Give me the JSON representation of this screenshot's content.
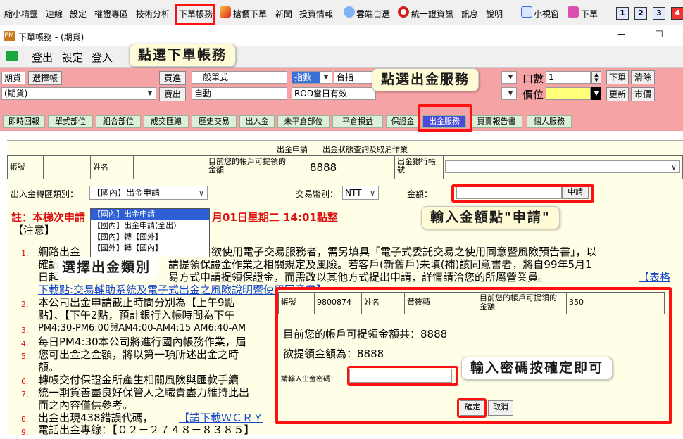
{
  "menubar": {
    "items": [
      "縮小精靈",
      "連線",
      "設定",
      "權證專區",
      "技術分析",
      "下單帳務",
      "搶價下單",
      "新聞",
      "投資情報",
      "雲端自選",
      "統一證資訊",
      "訊息",
      "說明",
      "小視窗",
      "下單"
    ],
    "num_buttons": [
      "1",
      "2",
      "3",
      "4"
    ]
  },
  "window": {
    "title": "下單帳務 - (期貨)",
    "logo": "EM",
    "minimize": "—",
    "maximize": "☐"
  },
  "toolbar": {
    "logout": "登出",
    "settings": "設定",
    "login": "登入"
  },
  "callouts": {
    "select_account": "點選下單帳務",
    "select_withdraw": "點選出金服務",
    "enter_amount": "輸入金額點\"申請\"",
    "select_type": "選擇出金類別",
    "enter_password": "輸入密碼按確定即可"
  },
  "order": {
    "account_type": "期貨",
    "select_account_btn": "選擇帳",
    "account_type2": "(期貨)",
    "buy_label": "買進",
    "sell_label": "賣出",
    "order_type": "一般單式",
    "auto": "自動",
    "index_select": "指數",
    "index_name": "台指",
    "rod": "ROD當日有效",
    "qty_label": "口數",
    "qty_value": "1",
    "price_label": "價位",
    "place_order": "下單",
    "clear": "清除",
    "update": "更新",
    "market_price": "市價"
  },
  "tabs": [
    "即時回報",
    "單式部位",
    "組合部位",
    "成交匯總",
    "歷史交易",
    "出入金",
    "未平倉部位",
    "平倉損益",
    "保證金",
    "出金服務",
    "買賣報告書",
    "個人服務"
  ],
  "form": {
    "subtab_apply": "出金申請",
    "subtab_query": "出金狀態查詢及取消作業",
    "account_label": "帳號",
    "name_label": "姓名",
    "available_label": "目前您的帳戶可提領的金額",
    "available_value": "8888",
    "bank_label": "出金銀行帳號",
    "transfer_type_label": "出入金轉匯類別：",
    "transfer_type_value": "【國內】出金申請",
    "currency_label": "交易幣別：",
    "currency_value": "NTT",
    "amount_label": "金額：",
    "apply_btn": "申請",
    "options": [
      "【國內】出金申請",
      "【國內】出金申請(全出)",
      "【國內】轉【國外】",
      "【國外】轉【國內】"
    ]
  },
  "notice": {
    "heading_left": "註：本梯次申請",
    "heading_right": "月01日星期二 14:01點整",
    "label": "【注意】",
    "lines": [
      {
        "num": "1.",
        "text": "網路出金",
        "text2": "欲使用電子交易服務者，需另填具「電子式委託交易之使用同意暨風險預告書」，以"
      },
      {
        "num": "",
        "text": "確認",
        "text2": "請提領保證金作業之相關規定及風險。若客戶(新舊戶)未填(補)該同意書者，將自99年5月1"
      },
      {
        "num": "",
        "text": "日起",
        "text2": "易方式申請提領保證金，而需改以其他方式提出申請，詳情請洽您的所屬營業員。"
      },
      {
        "num": "",
        "text": "下載點:交易輔助系統及電子式出金之風險說明暨使用同意書】",
        "text2": "【表格"
      },
      {
        "num": "2.",
        "text": "本公司出金申請截止時間分別為【上午9點"
      },
      {
        "num": "",
        "text": "點】、【下午2點，預計銀行入帳時間為下午"
      },
      {
        "num": "3.",
        "text": "PM4:30-PM6:00與AM4:00-AM4:15 AM6:40-AM"
      },
      {
        "num": "4.",
        "text": "每日PM4:30本公司將進行國內帳務作業，屆"
      },
      {
        "num": "5.",
        "text": "您可出金之金額，將以第一項所述出金之時"
      },
      {
        "num": "",
        "text": "額。"
      },
      {
        "num": "6.",
        "text": "轉帳交付保證金所產生相關風險與匯款手續"
      },
      {
        "num": "7.",
        "text": "統一期貨善盡良好保管人之職責盡力維持此出"
      },
      {
        "num": "",
        "text": "面之內容僅供參考。"
      },
      {
        "num": "8.",
        "text": "出金出現438錯誤代碼，",
        "link": "【請下載ＷＣＲＹ"
      },
      {
        "num": "9.",
        "text": "電話出金專線：【０２－２７４８－８３８５】"
      }
    ]
  },
  "dialog": {
    "account_label": "帳號",
    "account_value": "9800874",
    "name_label": "姓名",
    "name_value": "黃筱蘋",
    "available_label": "目前您的帳戶可提領的金額",
    "available_value": "350",
    "line1": "目前您的帳戶可提領金額共：8888",
    "line2": "欲提領金額為：8888",
    "password_label": "請輸入出金密碼：",
    "confirm": "確定",
    "cancel": "取消"
  },
  "colors": {
    "order_panel": "#f6a3a6",
    "active_tab": "#4b4bd8",
    "tab": "#dcefd8",
    "form_bg": "#ffffe7",
    "highlight": "#ff1111",
    "notice_red": "#dd1111",
    "link": "#1546c8"
  },
  "icons": [
    "lightning-icon",
    "cloud-icon",
    "record-icon",
    "window-icon",
    "order-icon",
    "logout-arrow-icon",
    "window-logo-icon"
  ]
}
